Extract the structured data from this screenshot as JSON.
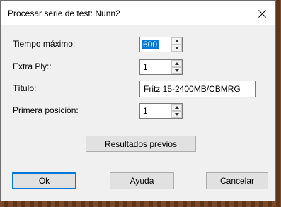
{
  "window": {
    "title": "Procesar serie de test: Nunn2"
  },
  "fields": {
    "tiempo_label": "Tiempo máximo:",
    "tiempo_value": "600",
    "extra_ply_label": "Extra Ply::",
    "extra_ply_value": "1",
    "titulo_label": "Título:",
    "titulo_value": "Fritz 15-2400MB/CBMRG",
    "primera_label": "Primera posición:",
    "primera_value": "1"
  },
  "buttons": {
    "resultados": "Resultados previos",
    "ok": "Ok",
    "ayuda": "Ayuda",
    "cancelar": "Cancelar"
  },
  "colors": {
    "selection": "#0078d7",
    "dialog_bg": "#f0f0f0",
    "button_bg": "#e1e1e1"
  }
}
